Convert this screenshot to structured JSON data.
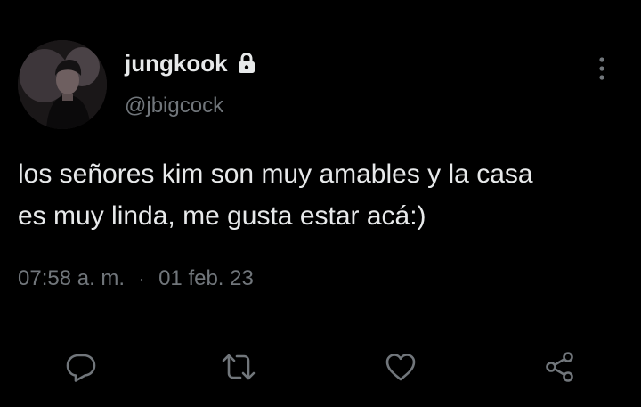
{
  "tweet": {
    "author": {
      "display_name": "jungkook",
      "handle": "@jbigcock",
      "protected_icon": "lock-icon"
    },
    "text": "los señores kim son muy amables y la casa\nes muy linda, me gusta estar acá:)",
    "time": "07:58 a. m.",
    "separator": "·",
    "date": "01 feb. 23"
  },
  "actions": [
    {
      "icon": "reply-icon"
    },
    {
      "icon": "retweet-icon"
    },
    {
      "icon": "like-icon"
    },
    {
      "icon": "share-icon"
    }
  ],
  "colors": {
    "background": "#000000",
    "primary_text": "#e7e9ea",
    "secondary_text": "#71767b",
    "icon": "#71767b",
    "divider": "#2f3336"
  }
}
